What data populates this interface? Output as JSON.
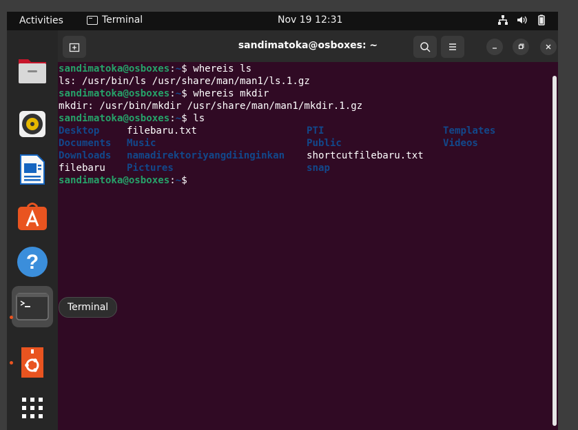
{
  "topbar": {
    "activities": "Activities",
    "app_name": "Terminal",
    "clock": "Nov 19  12:31"
  },
  "dock": {
    "tooltip": "Terminal",
    "items": [
      "files",
      "rhythmbox",
      "writer",
      "software",
      "help",
      "terminal",
      "ubuntu-usb-creator",
      "show-apps"
    ]
  },
  "window": {
    "title": "sandimatoka@osboxes: ~"
  },
  "terminal": {
    "prompt_user": "sandimatoka@osboxes",
    "prompt_sep": ":",
    "prompt_path": "~",
    "prompt_dollar": "$ ",
    "cmd1": "whereis ls",
    "out1": "ls: /usr/bin/ls /usr/share/man/man1/ls.1.gz",
    "cmd2": "whereis mkdir",
    "out2": "mkdir: /usr/bin/mkdir /usr/share/man/man1/mkdir.1.gz",
    "cmd3": "ls",
    "ls_rows": [
      [
        "Desktop",
        "filebaru.txt",
        "PTI",
        "Templates"
      ],
      [
        "Documents",
        "Music",
        "Public",
        "Videos"
      ],
      [
        "Downloads",
        "namadirektoriyangdiinginkan",
        "shortcutfilebaru.txt",
        ""
      ],
      [
        "filebaru",
        "Pictures",
        "snap",
        ""
      ]
    ]
  },
  "colors": {
    "terminal_bg": "#300a24",
    "prompt_user": "#26a269",
    "directory": "#12488b",
    "accent": "#e95420"
  }
}
